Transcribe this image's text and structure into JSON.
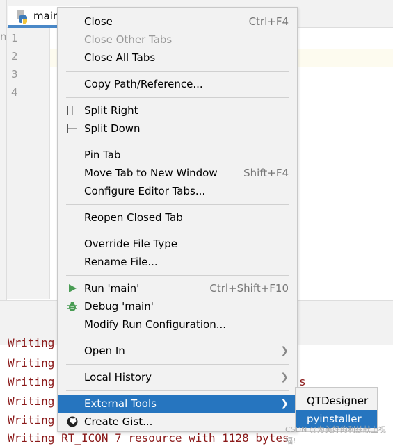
{
  "editor": {
    "tab_label": "main",
    "line_numbers": [
      "1",
      "2",
      "3",
      "4"
    ],
    "left_fragment": "n"
  },
  "console": {
    "lines": [
      "Writing",
      "Writing",
      "Writing",
      "Writing",
      "Writing",
      "Writing RT_ICON 7 resource with 1128 bytes"
    ],
    "right_fragments": [
      "s"
    ]
  },
  "menu": {
    "close": "Close",
    "close_shortcut": "Ctrl+F4",
    "close_other": "Close Other Tabs",
    "close_all": "Close All Tabs",
    "copy_path": "Copy Path/Reference...",
    "split_right": "Split Right",
    "split_down": "Split Down",
    "pin_tab": "Pin Tab",
    "move_tab": "Move Tab to New Window",
    "move_tab_shortcut": "Shift+F4",
    "configure_tabs": "Configure Editor Tabs...",
    "reopen": "Reopen Closed Tab",
    "override": "Override File Type",
    "rename": "Rename File...",
    "run": "Run 'main'",
    "run_shortcut": "Ctrl+Shift+F10",
    "debug": "Debug 'main'",
    "modify_run": "Modify Run Configuration...",
    "open_in": "Open In",
    "local_history": "Local History",
    "external_tools": "External Tools",
    "create_gist": "Create Gist..."
  },
  "submenu": {
    "items": [
      "QTDesigner",
      "pyinstaller"
    ],
    "selected": "pyinstaller"
  },
  "watermark": "CSDN @为美好的利兹献上祝福!",
  "colors": {
    "accent": "#2675bf",
    "run": "#499c54",
    "console_text": "#8b1a1a"
  }
}
